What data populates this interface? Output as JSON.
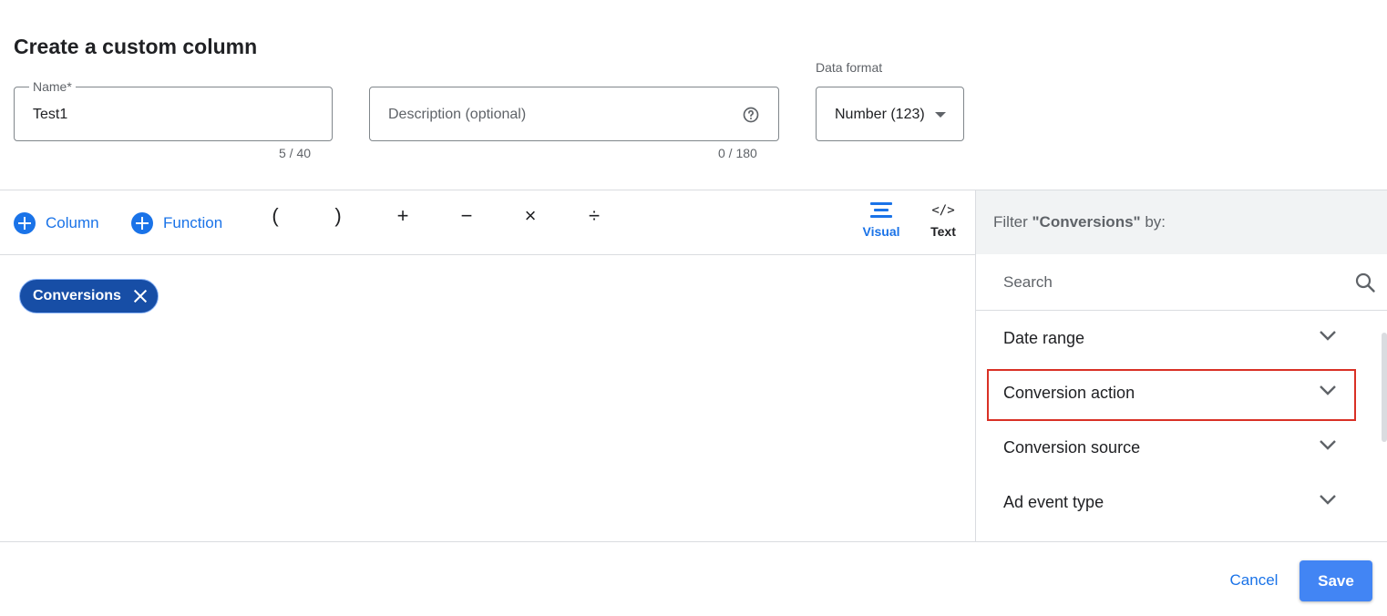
{
  "dialog": {
    "title": "Create a custom column"
  },
  "name_field": {
    "label": "Name*",
    "value": "Test1",
    "counter": "5 / 40"
  },
  "description_field": {
    "placeholder": "Description (optional)",
    "counter": "0 / 180",
    "icon": "help-icon"
  },
  "data_format": {
    "label": "Data format",
    "selected": "Number (123)"
  },
  "toolbar": {
    "column_label": "Column",
    "function_label": "Function",
    "operators": [
      "(",
      ")",
      "+",
      "−",
      "×",
      "÷"
    ],
    "modes": {
      "visual": "Visual",
      "text": "Text",
      "text_icon": "</>"
    }
  },
  "canvas": {
    "chip_label": "Conversions"
  },
  "filter_panel": {
    "header_prefix": "Filter ",
    "header_subject": "\"Conversions\"",
    "header_suffix": " by:",
    "search_placeholder": "Search",
    "items": [
      {
        "label": "Date range"
      },
      {
        "label": "Conversion action",
        "highlighted": true
      },
      {
        "label": "Conversion source"
      },
      {
        "label": "Ad event type"
      }
    ]
  },
  "footer": {
    "cancel_label": "Cancel",
    "save_label": "Save"
  },
  "colors": {
    "accent": "#1a73e8",
    "chip": "#174ea6",
    "save": "#4285f4",
    "highlight": "#d93025"
  }
}
